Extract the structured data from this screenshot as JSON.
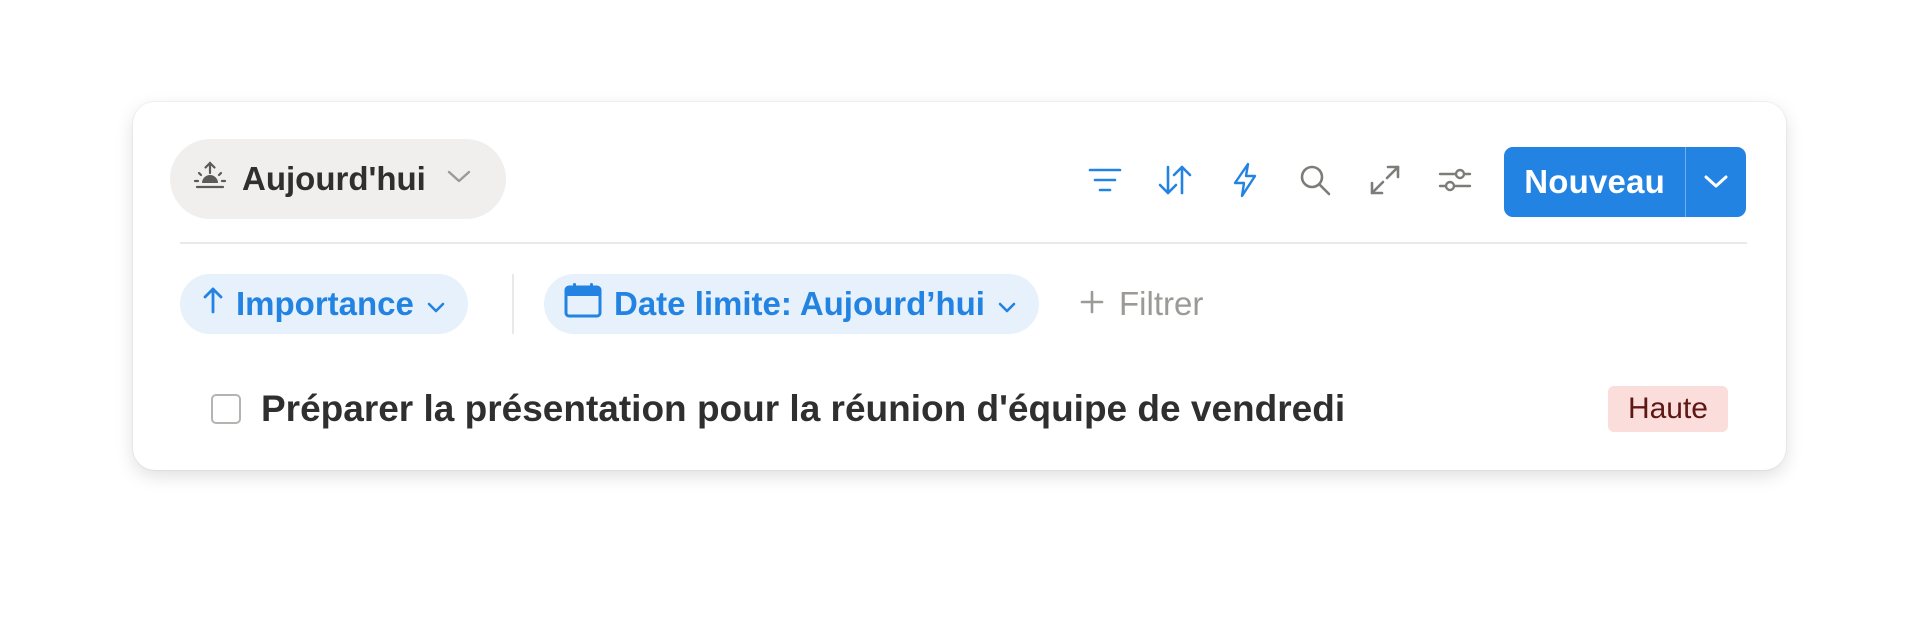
{
  "view": {
    "label": "Aujourd'hui",
    "icon": "sunrise-icon"
  },
  "toolbar": {
    "icons": [
      "filter-icon",
      "sort-icon",
      "automation-bolt-icon",
      "search-icon",
      "expand-icon",
      "settings-sliders-icon"
    ],
    "new_label": "Nouveau"
  },
  "filters": {
    "sort_chip": "Importance",
    "date_chip": "Date limite: Aujourd’hui",
    "add_filter": "Filtrer"
  },
  "tasks": [
    {
      "title": "Préparer la présentation pour la réunion d'équipe de vendredi",
      "priority": "Haute",
      "checked": false
    }
  ],
  "colors": {
    "accent": "#2383e2",
    "chip_bg": "#e7f1fc",
    "priority_bg": "#fbdddb"
  }
}
